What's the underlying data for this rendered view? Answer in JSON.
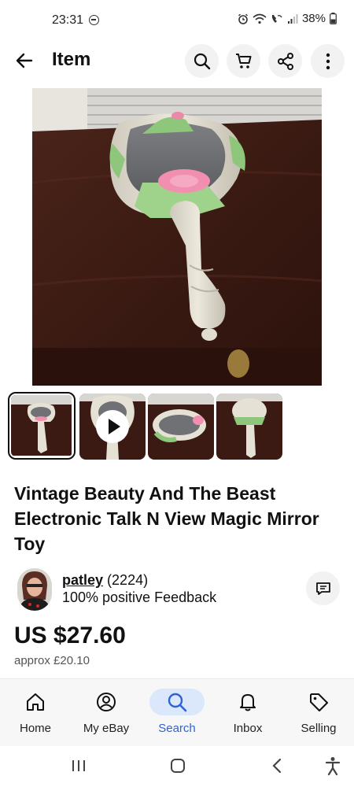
{
  "status_bar": {
    "time": "23:31",
    "battery": "38%"
  },
  "header": {
    "title": "Item",
    "icons": [
      "back-arrow-icon",
      "search-icon",
      "cart-icon",
      "share-icon",
      "more-vert-icon"
    ]
  },
  "gallery": {
    "hero_alt": "hand-mirror-photo",
    "thumbnails": [
      {
        "type": "photo",
        "selected": true
      },
      {
        "type": "video",
        "selected": false
      },
      {
        "type": "photo",
        "selected": false
      },
      {
        "type": "photo",
        "selected": false
      }
    ]
  },
  "item": {
    "title": "Vintage Beauty And The Beast Electronic Talk N View Magic Mirror Toy"
  },
  "seller": {
    "name": "patley",
    "score": "(2224)",
    "feedback": "100% positive Feedback"
  },
  "pricing": {
    "price": "US $27.60",
    "approx": "approx £20.10"
  },
  "bottom_nav": {
    "items": [
      {
        "label": "Home",
        "icon": "home-icon"
      },
      {
        "label": "My eBay",
        "icon": "user-circle-icon"
      },
      {
        "label": "Search",
        "icon": "search-icon",
        "active": true
      },
      {
        "label": "Inbox",
        "icon": "bell-icon"
      },
      {
        "label": "Selling",
        "icon": "tag-icon"
      }
    ]
  },
  "colors": {
    "accent": "#2e63d4",
    "accent_bg": "#dbe7fb",
    "text": "#111111"
  }
}
